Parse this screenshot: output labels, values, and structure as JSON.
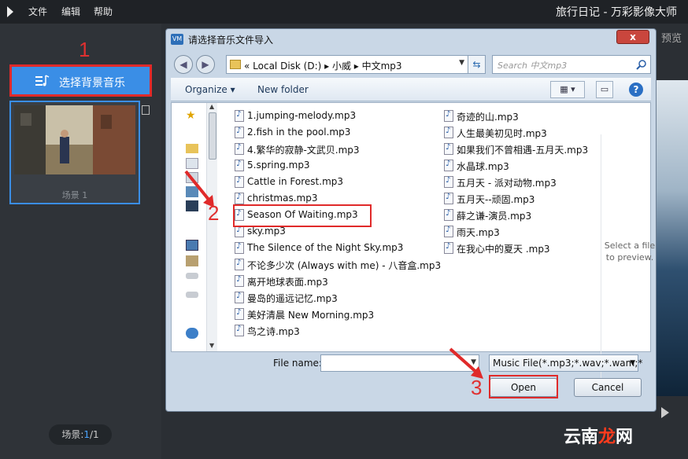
{
  "app": {
    "title": "旅行日记 - 万彩影像大师",
    "menu": [
      "文件",
      "编辑",
      "帮助"
    ],
    "preview_label": "预览"
  },
  "sidebar": {
    "bgm_button": "选择背景音乐",
    "scene_label": "场景 1",
    "scene_count_prefix": "场景:",
    "scene_count_current": "1",
    "scene_count_total": "/1"
  },
  "steps": [
    "1",
    "2",
    "3"
  ],
  "dialog": {
    "icon_text": "VM",
    "title": "请选择音乐文件导入",
    "close": "x",
    "address": "« Local Disk (D:)  ▸  小威  ▸  中文mp3",
    "search_placeholder": "Search 中文mp3",
    "toolbar": {
      "organize": "Organize ▾",
      "new_folder": "New folder"
    },
    "files_col1": [
      "1.jumping-melody.mp3",
      "2.fish in the pool.mp3",
      "4.繁华的寂静-文武贝.mp3",
      "5.spring.mp3",
      "Cattle in Forest.mp3",
      "christmas.mp3",
      "Season Of Waiting.mp3",
      "sky.mp3",
      "The Silence of the Night Sky.mp3",
      "不论多少次 (Always with me) - 八音盒.mp3",
      "离开地球表面.mp3",
      "曼岛的遥远记忆.mp3",
      "美好清晨 New Morning.mp3",
      "鸟之诗.mp3"
    ],
    "files_col2": [
      "奇迹的山.mp3",
      "人生最美初见时.mp3",
      "如果我们不曾相遇-五月天.mp3",
      "水晶球.mp3",
      "五月天 - 派对动物.mp3",
      "五月天--顽固.mp3",
      "薛之谦-演员.mp3",
      "雨天.mp3",
      "在我心中的夏天 .mp3"
    ],
    "preview_hint": "Select a file to preview.",
    "file_name_label": "File name:",
    "file_name_value": "",
    "filter": "Music File(*.mp3;*.wav;*.wam;*",
    "open_button": "Open",
    "cancel_button": "Cancel"
  },
  "watermark": {
    "part1": "云南",
    "part2": "龙",
    "part3": "网"
  },
  "colors": {
    "accent": "#3a8ee6",
    "highlight": "#e02a2a"
  }
}
